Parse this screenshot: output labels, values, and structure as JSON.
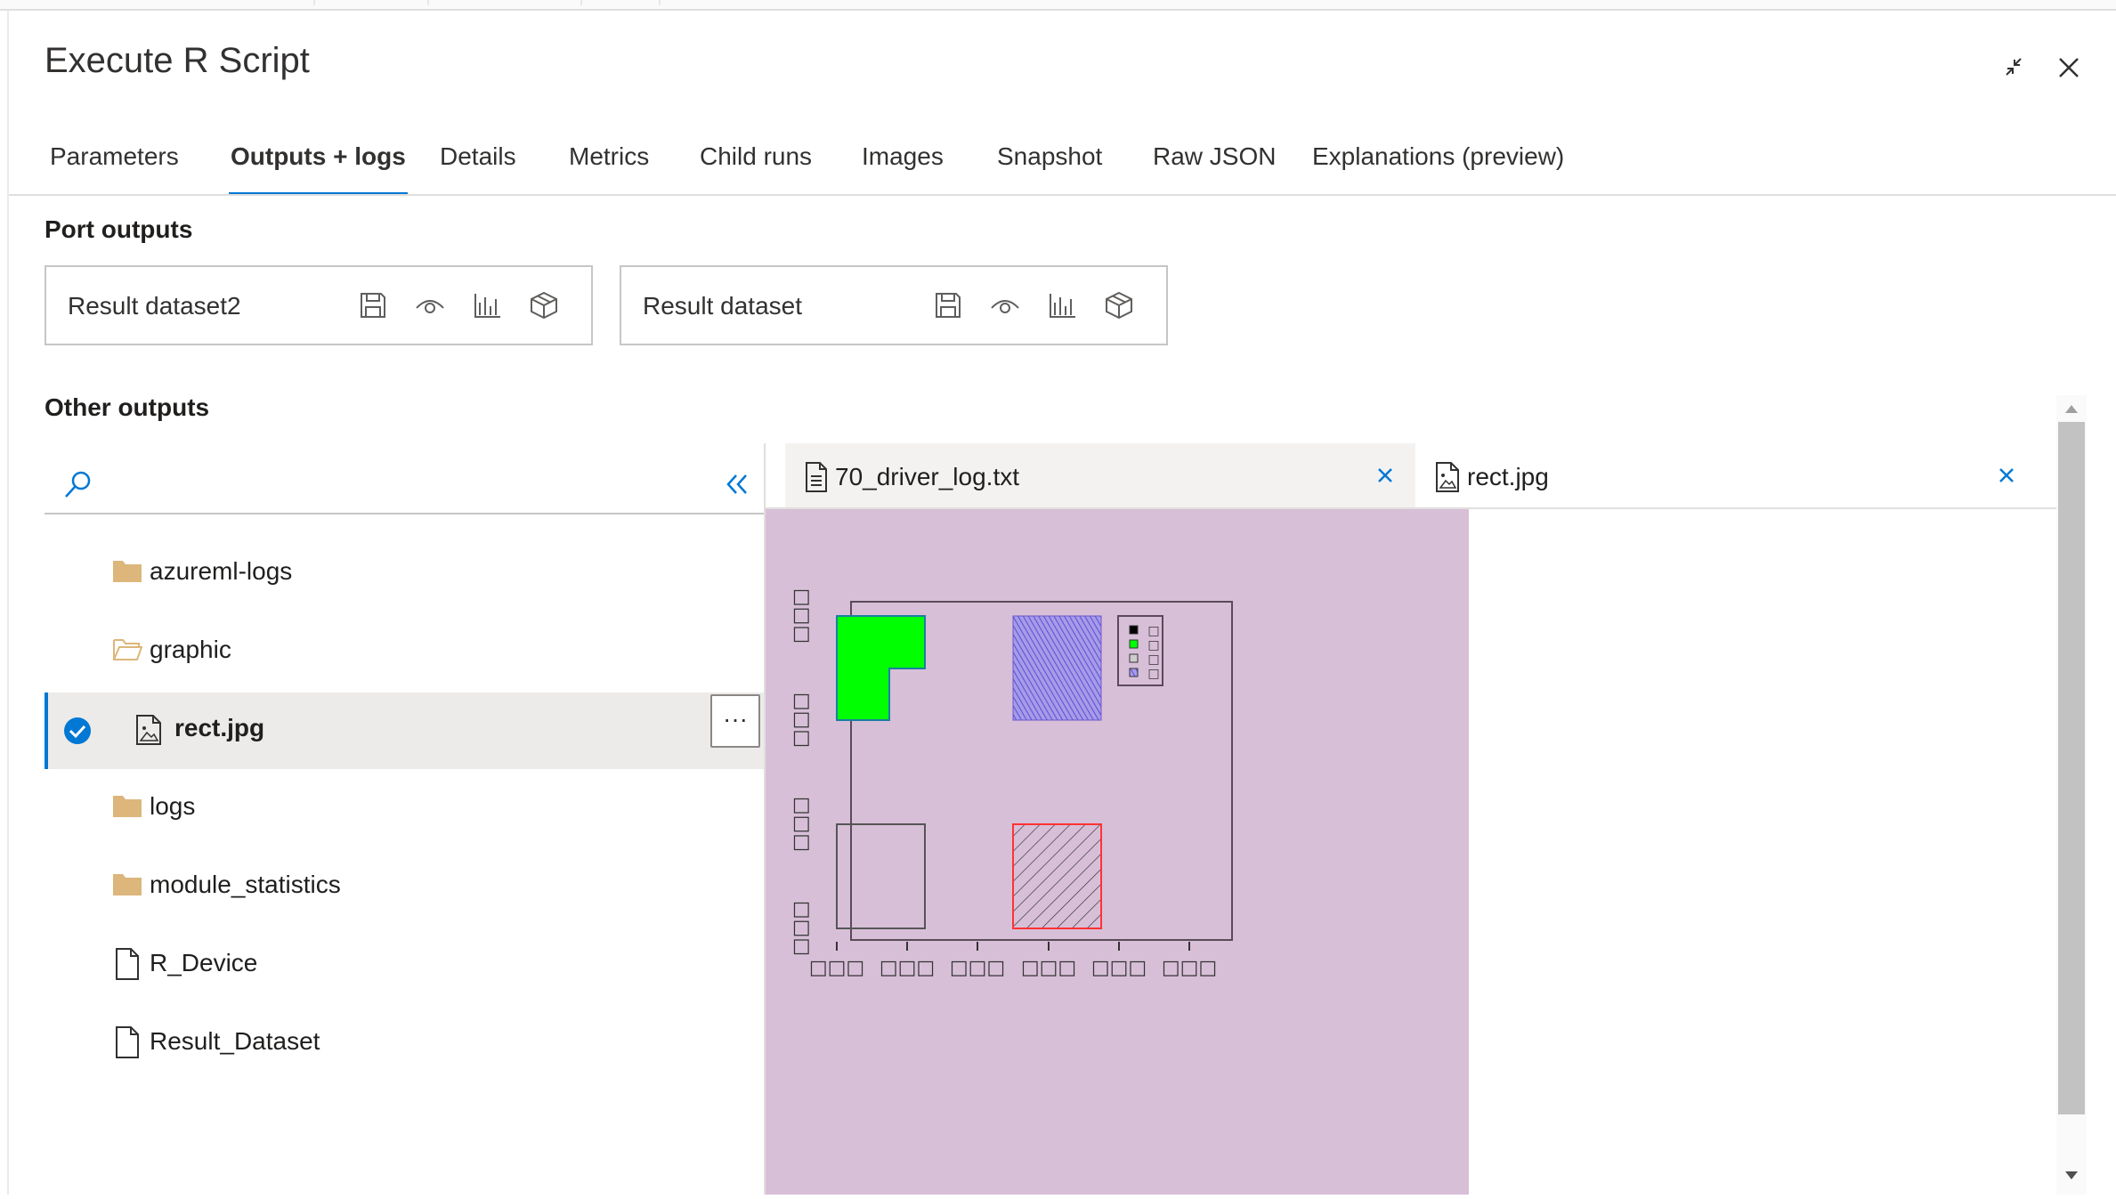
{
  "header": {
    "title": "Execute R Script"
  },
  "tabs": [
    {
      "label": "Parameters",
      "active": false
    },
    {
      "label": "Outputs + logs",
      "active": true
    },
    {
      "label": "Details",
      "active": false
    },
    {
      "label": "Metrics",
      "active": false
    },
    {
      "label": "Child runs",
      "active": false
    },
    {
      "label": "Images",
      "active": false
    },
    {
      "label": "Snapshot",
      "active": false
    },
    {
      "label": "Raw JSON",
      "active": false
    },
    {
      "label": "Explanations (preview)",
      "active": false
    }
  ],
  "port_outputs": {
    "heading": "Port outputs",
    "items": [
      {
        "label": "Result dataset2",
        "icons": [
          "save-icon",
          "eye-icon",
          "bar-chart-icon",
          "register-dataset-icon"
        ]
      },
      {
        "label": "Result dataset",
        "icons": [
          "save-icon",
          "eye-icon",
          "bar-chart-icon",
          "register-dataset-icon"
        ]
      }
    ]
  },
  "other_outputs": {
    "heading": "Other outputs",
    "search_icon": "search-icon",
    "collapse_icon": "double-chevron-left-icon",
    "tree": [
      {
        "label": "azureml-logs",
        "icon": "folder-icon",
        "selected": false
      },
      {
        "label": "graphic",
        "icon": "folder-open-icon",
        "selected": false
      },
      {
        "label": "rect.jpg",
        "icon": "image-file-icon",
        "selected": true
      },
      {
        "label": "logs",
        "icon": "folder-icon",
        "selected": false
      },
      {
        "label": "module_statistics",
        "icon": "folder-icon",
        "selected": false
      },
      {
        "label": "R_Device",
        "icon": "file-icon",
        "selected": false
      },
      {
        "label": "Result_Dataset",
        "icon": "file-icon",
        "selected": false
      }
    ],
    "more_label": "···"
  },
  "file_tabs": [
    {
      "label": "70_driver_log.txt",
      "icon": "text-file-icon",
      "active": true
    },
    {
      "label": "rect.jpg",
      "icon": "image-file-icon",
      "active": false
    }
  ],
  "chart_data": {
    "type": "other",
    "title": "",
    "xlabel": "",
    "ylabel": "",
    "x_ticks": [
      "□□□",
      "□□□",
      "□□□",
      "□□□",
      "□□□",
      "□□□"
    ],
    "y_ticks": [
      "□□□",
      "□□□",
      "□□□",
      "□□□"
    ],
    "background": "#d8bfd8",
    "rectangles": [
      {
        "name": "green",
        "fill": "#00ff00",
        "border": "#1a7fa0",
        "shape": "L"
      },
      {
        "name": "blue-hatched",
        "fill": "#7b68ee",
        "border": "#6a5acd"
      },
      {
        "name": "empty",
        "fill": "none",
        "border": "#555555"
      },
      {
        "name": "red-hatched",
        "fill": "#444444",
        "border": "#ff3333"
      }
    ],
    "legend": {
      "position": "top-right",
      "entries": [
        "□",
        "□",
        "□",
        "□"
      ],
      "swatches": [
        "#000000",
        "#00ff00",
        "#cccccc",
        "#7b68ee"
      ]
    }
  },
  "colors": {
    "accent": "#0078d4",
    "folder": "#dcb67a"
  }
}
